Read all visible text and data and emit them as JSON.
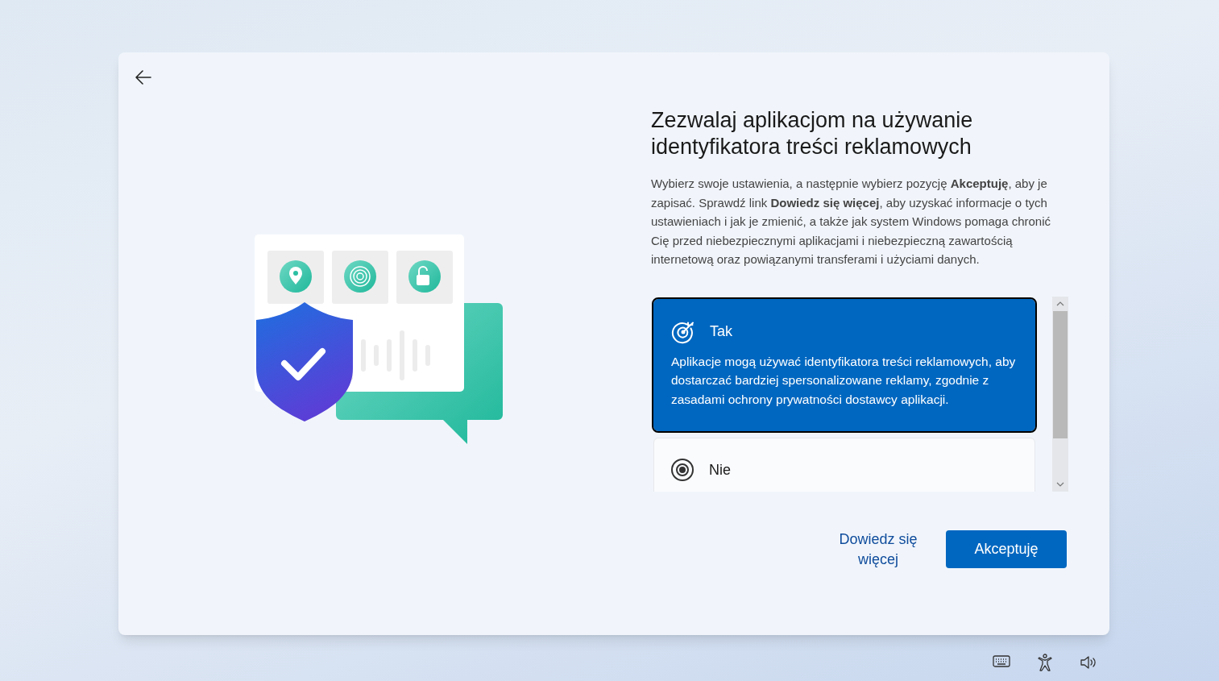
{
  "title": "Zezwalaj aplikacjom na używanie identyfikatora treści reklamowych",
  "description": "Wybierz swoje ustawienia, a następnie wybierz pozycję **Akceptuję**, aby je zapisać. Sprawdź link **Dowiedz się więcej**, aby uzyskać informacje o tych ustawieniach i jak je zmienić, a także jak system Windows pomaga chronić Cię przed niebezpiecznymi aplikacjami i niebezpieczną zawartością internetową oraz powiązanymi transferami i użyciami danych.",
  "options": [
    {
      "label": "Tak",
      "description": "Aplikacje mogą używać identyfikatora treści reklamowych, aby dostarczać bardziej spersonalizowane reklamy, zgodnie z zasadami ochrony prywatności dostawcy aplikacji.",
      "selected": true
    },
    {
      "label": "Nie",
      "selected": false
    }
  ],
  "learn_more_link": "Dowiedz się więcej",
  "accept_button": "Akceptuję"
}
